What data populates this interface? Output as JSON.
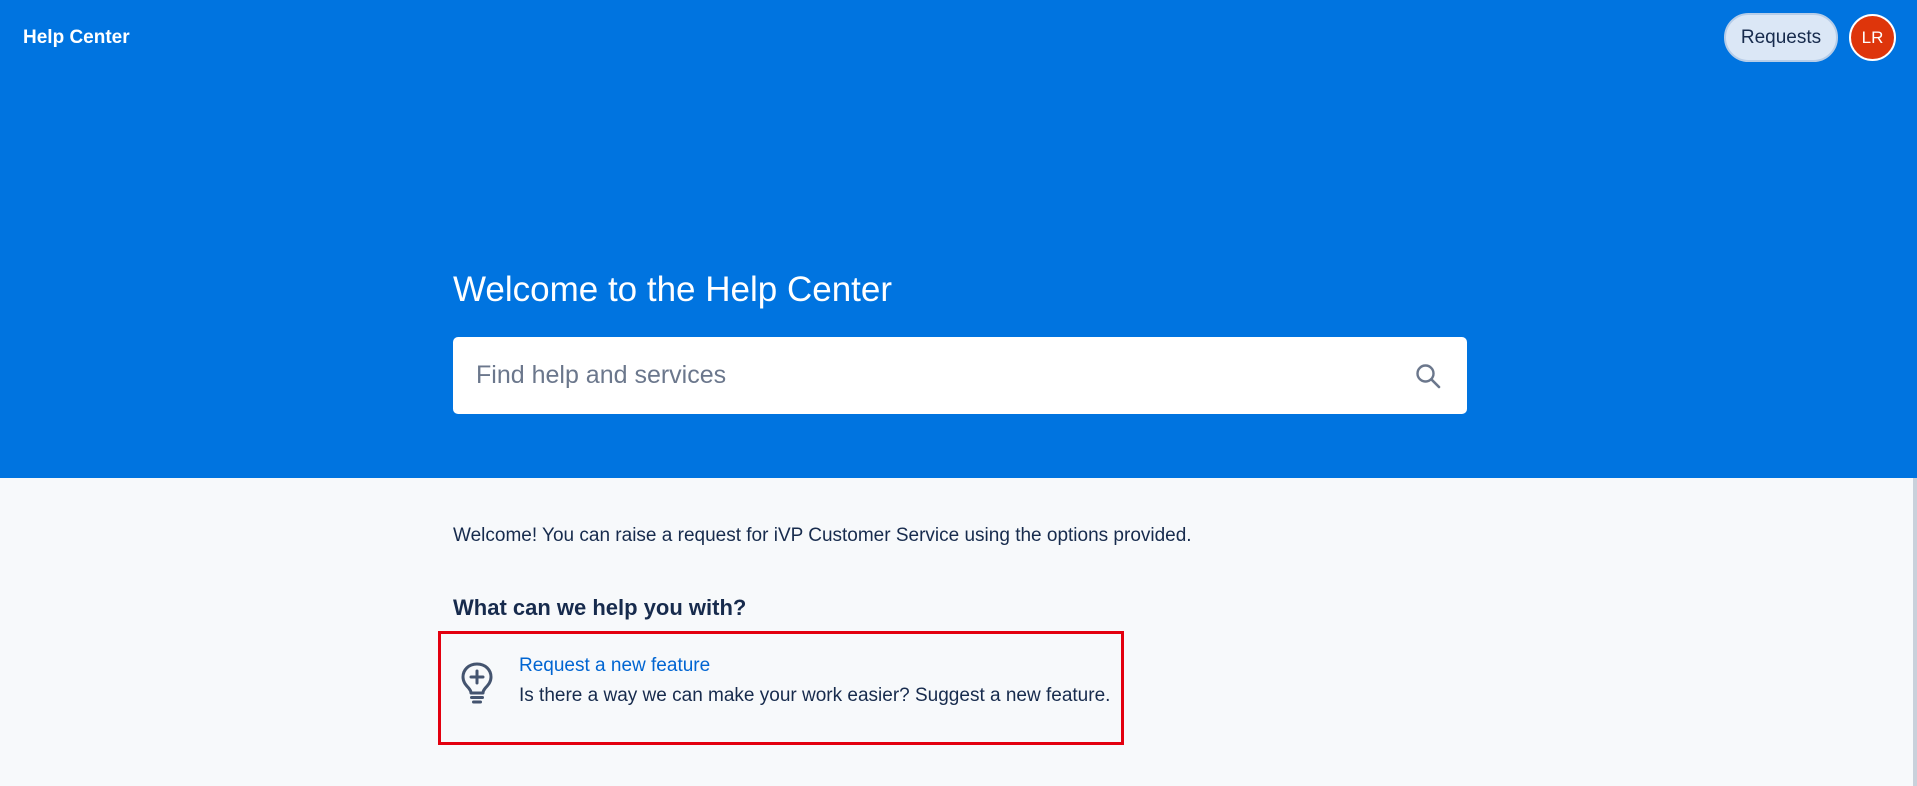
{
  "header": {
    "site_title": "Help Center",
    "requests_label": "Requests",
    "avatar_initials": "LR"
  },
  "hero": {
    "title": "Welcome to the Help Center",
    "search": {
      "placeholder": "Find help and services",
      "value": ""
    }
  },
  "main": {
    "intro": "Welcome! You can raise a request for iVP Customer Service using the options provided.",
    "section_heading": "What can we help you with?",
    "options": [
      {
        "icon": "lightbulb-plus-icon",
        "title": "Request a new feature",
        "description": "Is there a way we can make your work easier? Suggest a new feature."
      }
    ]
  },
  "colors": {
    "hero_background": "#0074e0",
    "page_background": "#f7f9fb",
    "link": "#0065d2",
    "avatar": "#de350b",
    "highlight_border": "#e3000f"
  }
}
